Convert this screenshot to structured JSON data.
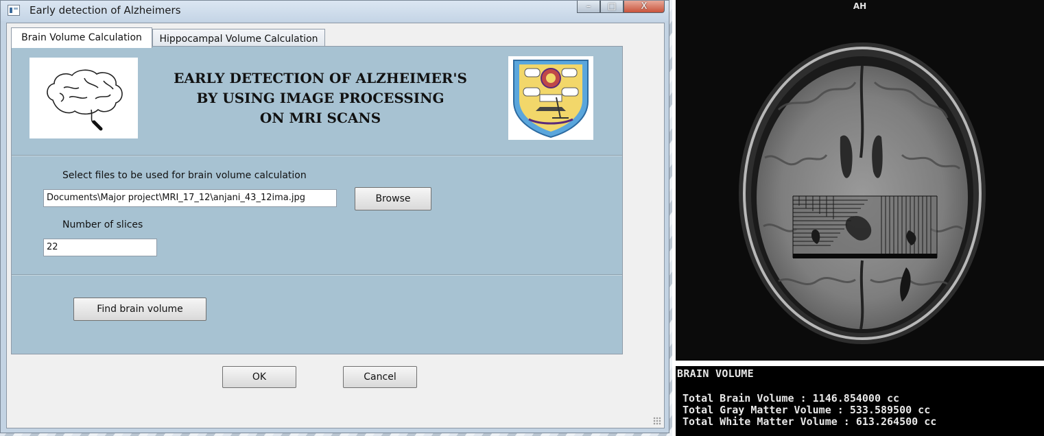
{
  "window": {
    "title": "Early detection of Alzheimers",
    "caption_minimize": "–",
    "caption_maximize": "□",
    "caption_close": "X"
  },
  "tabs": [
    {
      "label": "Brain Volume Calculation",
      "active": true
    },
    {
      "label": "Hippocampal Volume Calculation",
      "active": false
    }
  ],
  "header": {
    "line1": "EARLY DETECTION OF ALZHEIMER'S",
    "line2": "BY USING IMAGE PROCESSING",
    "line3": "ON MRI SCANS"
  },
  "form": {
    "file_label": "Select files to be used for brain volume calculation",
    "file_value": "Documents\\Major project\\MRI_17_12\\anjani_43_12ima.jpg",
    "browse_label": "Browse",
    "slices_label": "Number of slices",
    "slices_value": "22",
    "find_label": "Find brain volume"
  },
  "footer": {
    "ok_label": "OK",
    "cancel_label": "Cancel"
  },
  "mri": {
    "orientation_label": "AH"
  },
  "console": {
    "title": "BRAIN VOLUME",
    "lines": [
      "Total Brain Volume : 1146.854000 cc",
      "Total Gray Matter Volume : 533.589500 cc",
      "Total White Matter Volume : 613.264500 cc"
    ]
  },
  "colors": {
    "panel": "#a7c2d2",
    "window_frame": "#c3d3e3",
    "console_bg": "#000000"
  }
}
